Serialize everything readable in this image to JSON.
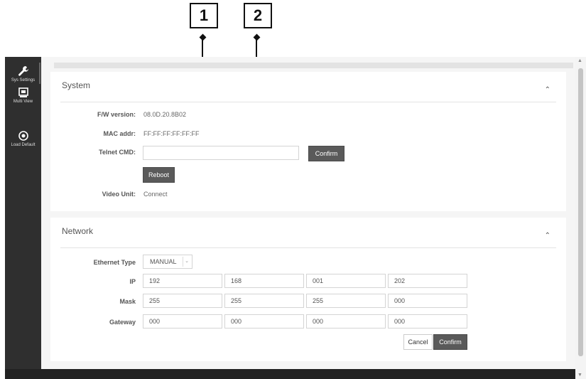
{
  "callouts": [
    "1",
    "2"
  ],
  "sidebar": {
    "items": [
      {
        "label": "Sys Settings",
        "icon": "wrench-icon"
      },
      {
        "label": "Multi View",
        "icon": "multi-view-icon"
      },
      {
        "label": "Load Default",
        "icon": "target-icon"
      }
    ]
  },
  "system": {
    "title": "System",
    "fw_label": "F/W version:",
    "fw_value": "08.0D.20.8B02",
    "mac_label": "MAC addr:",
    "mac_value": "FF:FF:FF:FF:FF:FF",
    "telnet_label": "Telnet CMD:",
    "telnet_value": "",
    "confirm_label": "Confirm",
    "reboot_label": "Reboot",
    "video_label": "Video Unit:",
    "video_value": "Connect"
  },
  "network": {
    "title": "Network",
    "ethernet_label": "Ethernet Type",
    "ethernet_value": "MANUAL",
    "ip_label": "IP",
    "ip": [
      "192",
      "168",
      "001",
      "202"
    ],
    "mask_label": "Mask",
    "mask": [
      "255",
      "255",
      "255",
      "000"
    ],
    "gateway_label": "Gateway",
    "gateway": [
      "000",
      "000",
      "000",
      "000"
    ],
    "cancel_label": "Cancel",
    "confirm_label": "Confirm"
  },
  "colors": {
    "sidebar": "#2f2f2f",
    "button_dark": "#5a5a5a",
    "background": "#f5f5f5"
  }
}
